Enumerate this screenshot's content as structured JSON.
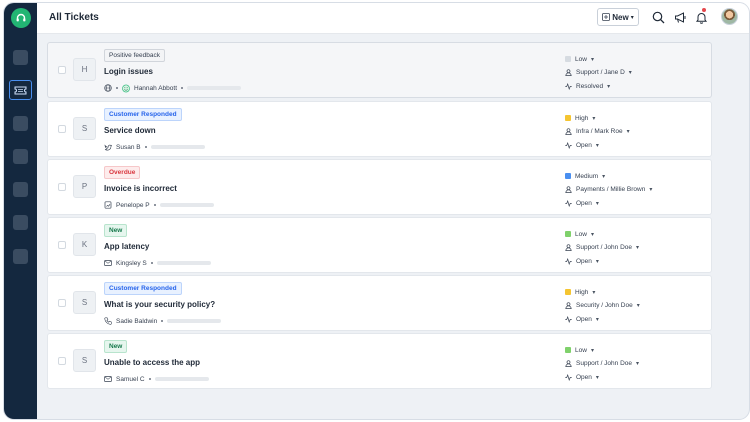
{
  "header": {
    "title": "All Tickets",
    "new_label": "New"
  },
  "colors": {
    "sidebar": "#14283f",
    "brand": "#22b573",
    "active_nav": "#4a8ff0",
    "priority_low": "#d6dbe1",
    "priority_high": "#f5c531",
    "priority_medium": "#4a8ff0",
    "priority_low_green": "#7fd16b"
  },
  "tickets": [
    {
      "letter": "H",
      "tag": "Positive feedback",
      "subject": "Login issues",
      "requester": "Hannah Abbott",
      "priority": "Low",
      "group": "Support / Jane D",
      "status": "Resolved"
    },
    {
      "letter": "S",
      "tag": "Customer Responded",
      "subject": "Service down",
      "requester": "Susan B",
      "priority": "High",
      "group": "Infra / Mark Roe",
      "status": "Open"
    },
    {
      "letter": "P",
      "tag": "Overdue",
      "subject": "Invoice is incorrect",
      "requester": "Penelope P",
      "priority": "Medium",
      "group": "Payments / Millie Brown",
      "status": "Open"
    },
    {
      "letter": "K",
      "tag": "New",
      "subject": "App latency",
      "requester": "Kingsley S",
      "priority": "Low",
      "group": "Support / John Doe",
      "status": "Open"
    },
    {
      "letter": "S",
      "tag": "Customer Responded",
      "subject": "What is your security policy?",
      "requester": "Sadie Baldwin",
      "priority": "High",
      "group": "Security / John Doe",
      "status": "Open"
    },
    {
      "letter": "S",
      "tag": "New",
      "subject": "Unable to access the app",
      "requester": "Samuel C",
      "priority": "Low",
      "group": "Support / John Doe",
      "status": "Open"
    }
  ]
}
